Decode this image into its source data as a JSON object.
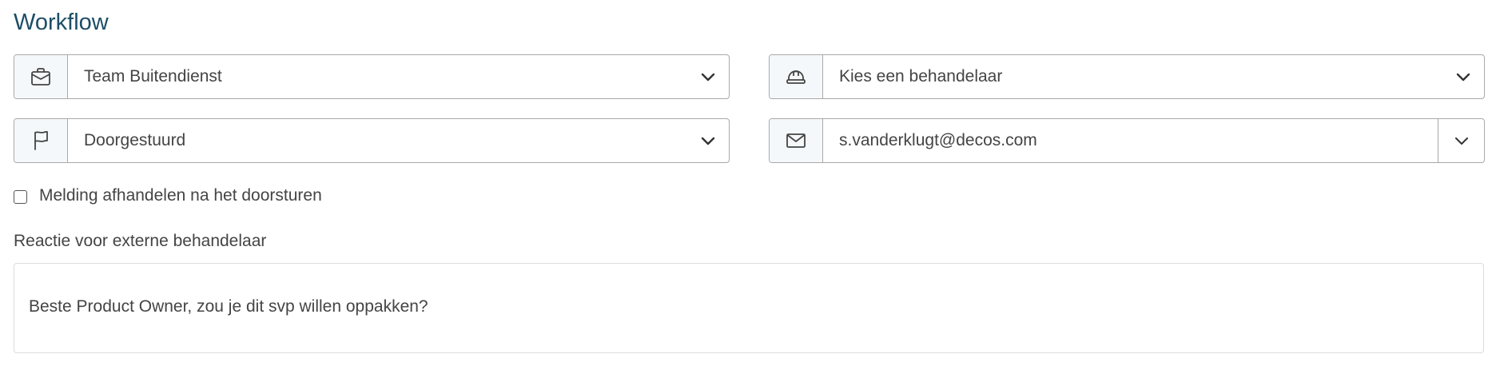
{
  "section": {
    "title": "Workflow"
  },
  "fields": {
    "team": {
      "value": "Team Buitendienst",
      "icon": "briefcase-icon"
    },
    "handler": {
      "value": "Kies een behandelaar",
      "icon": "hard-hat-icon"
    },
    "status": {
      "value": "Doorgestuurd",
      "icon": "flag-icon"
    },
    "email": {
      "value": "s.vanderklugt@decos.com",
      "icon": "envelope-icon"
    }
  },
  "checkbox": {
    "label": "Melding afhandelen na het doorsturen",
    "checked": false
  },
  "reaction": {
    "label": "Reactie voor externe behandelaar",
    "value": "Beste Product Owner, zou je dit svp willen oppakken?"
  },
  "colors": {
    "title": "#1d4e66",
    "text": "#444444",
    "border": "#a9a9a9",
    "addon_bg": "#f5f8fa"
  }
}
